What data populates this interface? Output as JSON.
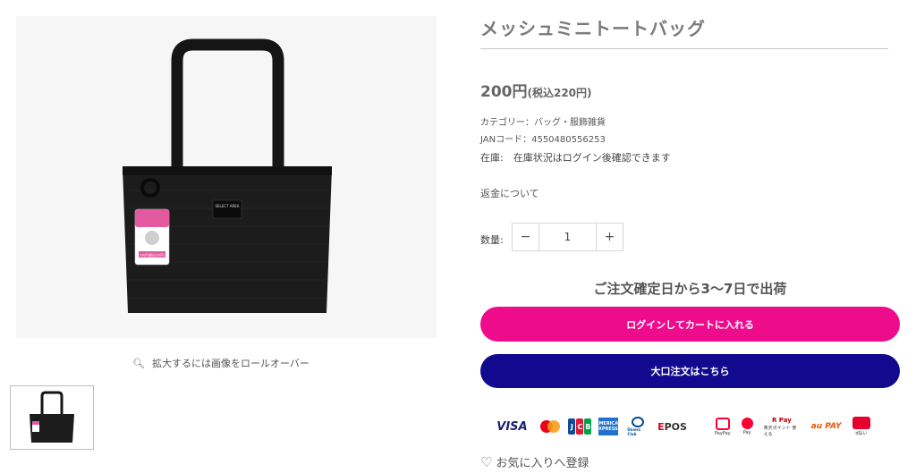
{
  "product": {
    "title": "メッシュミニトートバッグ",
    "price_main": "200円",
    "price_tax": "(税込220円)",
    "category": "カテゴリー：バッグ・服飾雑貨",
    "jan": "JANコード：4550480556253",
    "stock": "在庫:　在庫状況はログイン後確認できます",
    "refund_link": "返金について"
  },
  "gallery": {
    "zoom_hint": "拡大するには画像をロールオーバー",
    "tag_text": "200円(税込220円)",
    "label_text": "SELECT AREA"
  },
  "quantity": {
    "label": "数量:",
    "minus": "−",
    "value": "1",
    "plus": "+"
  },
  "shipping": "ご注文確定日から3〜7日で出荷",
  "buttons": {
    "cart": "ログインしてカートに入れる",
    "bulk": "大口注文はこちら"
  },
  "payments": {
    "visa": "VISA",
    "amex": "AMERICAN EXPRESS",
    "diners": "Diners Club",
    "epos": "EPOS",
    "paypay_label": "PayPay",
    "pay_label": "Pay",
    "rpay": "R Pay",
    "rpay_sub": "楽天ポイント 使える",
    "aupay": "au PAY",
    "dbarai": "d払い"
  },
  "favorite": "お気に入りへ登録",
  "colors": {
    "cart_button": "#ee0c8d",
    "bulk_button": "#110a8f"
  }
}
